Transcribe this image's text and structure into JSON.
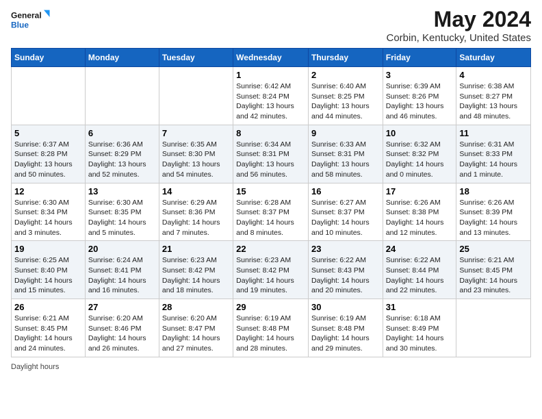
{
  "logo": {
    "line1": "General",
    "line2": "Blue"
  },
  "title": "May 2024",
  "subtitle": "Corbin, Kentucky, United States",
  "days_of_week": [
    "Sunday",
    "Monday",
    "Tuesday",
    "Wednesday",
    "Thursday",
    "Friday",
    "Saturday"
  ],
  "weeks": [
    [
      {
        "day": "",
        "info": ""
      },
      {
        "day": "",
        "info": ""
      },
      {
        "day": "",
        "info": ""
      },
      {
        "day": "1",
        "info": "Sunrise: 6:42 AM\nSunset: 8:24 PM\nDaylight: 13 hours and 42 minutes."
      },
      {
        "day": "2",
        "info": "Sunrise: 6:40 AM\nSunset: 8:25 PM\nDaylight: 13 hours and 44 minutes."
      },
      {
        "day": "3",
        "info": "Sunrise: 6:39 AM\nSunset: 8:26 PM\nDaylight: 13 hours and 46 minutes."
      },
      {
        "day": "4",
        "info": "Sunrise: 6:38 AM\nSunset: 8:27 PM\nDaylight: 13 hours and 48 minutes."
      }
    ],
    [
      {
        "day": "5",
        "info": "Sunrise: 6:37 AM\nSunset: 8:28 PM\nDaylight: 13 hours and 50 minutes."
      },
      {
        "day": "6",
        "info": "Sunrise: 6:36 AM\nSunset: 8:29 PM\nDaylight: 13 hours and 52 minutes."
      },
      {
        "day": "7",
        "info": "Sunrise: 6:35 AM\nSunset: 8:30 PM\nDaylight: 13 hours and 54 minutes."
      },
      {
        "day": "8",
        "info": "Sunrise: 6:34 AM\nSunset: 8:31 PM\nDaylight: 13 hours and 56 minutes."
      },
      {
        "day": "9",
        "info": "Sunrise: 6:33 AM\nSunset: 8:31 PM\nDaylight: 13 hours and 58 minutes."
      },
      {
        "day": "10",
        "info": "Sunrise: 6:32 AM\nSunset: 8:32 PM\nDaylight: 14 hours and 0 minutes."
      },
      {
        "day": "11",
        "info": "Sunrise: 6:31 AM\nSunset: 8:33 PM\nDaylight: 14 hours and 1 minute."
      }
    ],
    [
      {
        "day": "12",
        "info": "Sunrise: 6:30 AM\nSunset: 8:34 PM\nDaylight: 14 hours and 3 minutes."
      },
      {
        "day": "13",
        "info": "Sunrise: 6:30 AM\nSunset: 8:35 PM\nDaylight: 14 hours and 5 minutes."
      },
      {
        "day": "14",
        "info": "Sunrise: 6:29 AM\nSunset: 8:36 PM\nDaylight: 14 hours and 7 minutes."
      },
      {
        "day": "15",
        "info": "Sunrise: 6:28 AM\nSunset: 8:37 PM\nDaylight: 14 hours and 8 minutes."
      },
      {
        "day": "16",
        "info": "Sunrise: 6:27 AM\nSunset: 8:37 PM\nDaylight: 14 hours and 10 minutes."
      },
      {
        "day": "17",
        "info": "Sunrise: 6:26 AM\nSunset: 8:38 PM\nDaylight: 14 hours and 12 minutes."
      },
      {
        "day": "18",
        "info": "Sunrise: 6:26 AM\nSunset: 8:39 PM\nDaylight: 14 hours and 13 minutes."
      }
    ],
    [
      {
        "day": "19",
        "info": "Sunrise: 6:25 AM\nSunset: 8:40 PM\nDaylight: 14 hours and 15 minutes."
      },
      {
        "day": "20",
        "info": "Sunrise: 6:24 AM\nSunset: 8:41 PM\nDaylight: 14 hours and 16 minutes."
      },
      {
        "day": "21",
        "info": "Sunrise: 6:23 AM\nSunset: 8:42 PM\nDaylight: 14 hours and 18 minutes."
      },
      {
        "day": "22",
        "info": "Sunrise: 6:23 AM\nSunset: 8:42 PM\nDaylight: 14 hours and 19 minutes."
      },
      {
        "day": "23",
        "info": "Sunrise: 6:22 AM\nSunset: 8:43 PM\nDaylight: 14 hours and 20 minutes."
      },
      {
        "day": "24",
        "info": "Sunrise: 6:22 AM\nSunset: 8:44 PM\nDaylight: 14 hours and 22 minutes."
      },
      {
        "day": "25",
        "info": "Sunrise: 6:21 AM\nSunset: 8:45 PM\nDaylight: 14 hours and 23 minutes."
      }
    ],
    [
      {
        "day": "26",
        "info": "Sunrise: 6:21 AM\nSunset: 8:45 PM\nDaylight: 14 hours and 24 minutes."
      },
      {
        "day": "27",
        "info": "Sunrise: 6:20 AM\nSunset: 8:46 PM\nDaylight: 14 hours and 26 minutes."
      },
      {
        "day": "28",
        "info": "Sunrise: 6:20 AM\nSunset: 8:47 PM\nDaylight: 14 hours and 27 minutes."
      },
      {
        "day": "29",
        "info": "Sunrise: 6:19 AM\nSunset: 8:48 PM\nDaylight: 14 hours and 28 minutes."
      },
      {
        "day": "30",
        "info": "Sunrise: 6:19 AM\nSunset: 8:48 PM\nDaylight: 14 hours and 29 minutes."
      },
      {
        "day": "31",
        "info": "Sunrise: 6:18 AM\nSunset: 8:49 PM\nDaylight: 14 hours and 30 minutes."
      },
      {
        "day": "",
        "info": ""
      }
    ]
  ],
  "footer": "Daylight hours"
}
